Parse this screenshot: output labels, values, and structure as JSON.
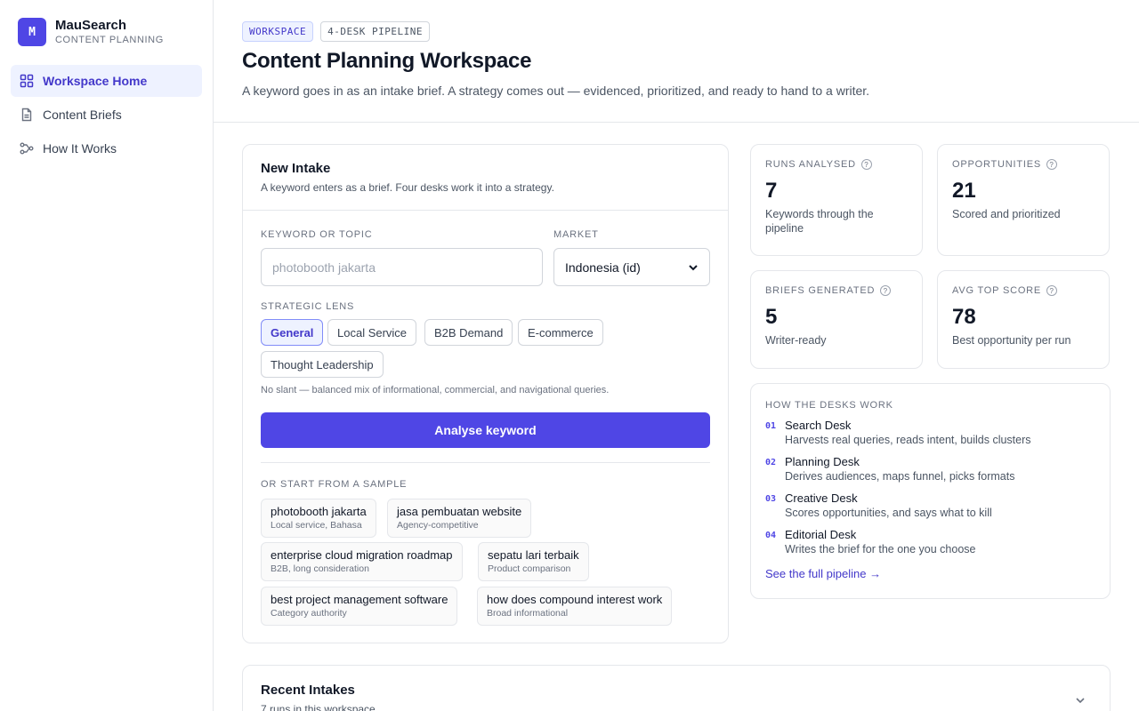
{
  "sidebar": {
    "logo_letter": "M",
    "brand_name": "MauSearch",
    "brand_sub": "CONTENT PLANNING",
    "items": [
      {
        "label": "Workspace Home",
        "icon": "grid-icon",
        "active": true
      },
      {
        "label": "Content Briefs",
        "icon": "document-icon",
        "active": false
      },
      {
        "label": "How It Works",
        "icon": "flow-icon",
        "active": false
      }
    ]
  },
  "header": {
    "tags": [
      "WORKSPACE",
      "4-DESK PIPELINE"
    ],
    "title": "Content Planning Workspace",
    "description": "A keyword goes in as an intake brief. A strategy comes out — evidenced, prioritized, and ready to hand to a writer."
  },
  "intake": {
    "title": "New Intake",
    "subtitle": "A keyword enters as a brief. Four desks work it into a strategy.",
    "keyword_label": "KEYWORD OR TOPIC",
    "keyword_placeholder": "photobooth jakarta",
    "market_label": "MARKET",
    "market_value": "Indonesia (id)",
    "lens_label": "STRATEGIC LENS",
    "lenses": [
      "General",
      "Local Service",
      "B2B Demand",
      "E-commerce",
      "Thought Leadership"
    ],
    "active_lens": "General",
    "lens_hint": "No slant — balanced mix of informational, commercial, and navigational queries.",
    "analyse_label": "Analyse keyword",
    "samples_label": "OR START FROM A SAMPLE",
    "samples": [
      {
        "title": "photobooth jakarta",
        "sub": "Local service, Bahasa"
      },
      {
        "title": "jasa pembuatan website",
        "sub": "Agency-competitive"
      },
      {
        "title": "enterprise cloud migration roadmap",
        "sub": "B2B, long consideration"
      },
      {
        "title": "sepatu lari terbaik",
        "sub": "Product comparison"
      },
      {
        "title": "best project management software",
        "sub": "Category authority"
      },
      {
        "title": "how does compound interest work",
        "sub": "Broad informational"
      }
    ]
  },
  "stats": [
    {
      "label": "RUNS ANALYSED",
      "value": "7",
      "desc": "Keywords through the pipeline"
    },
    {
      "label": "OPPORTUNITIES",
      "value": "21",
      "desc": "Scored and prioritized"
    },
    {
      "label": "BRIEFS GENERATED",
      "value": "5",
      "desc": "Writer-ready"
    },
    {
      "label": "AVG TOP SCORE",
      "value": "78",
      "desc": "Best opportunity per run"
    }
  ],
  "desks": {
    "label": "HOW THE DESKS WORK",
    "items": [
      {
        "num": "01",
        "name": "Search Desk",
        "text": "Harvests real queries, reads intent, builds clusters"
      },
      {
        "num": "02",
        "name": "Planning Desk",
        "text": "Derives audiences, maps funnel, picks formats"
      },
      {
        "num": "03",
        "name": "Creative Desk",
        "text": "Scores opportunities, and says what to kill"
      },
      {
        "num": "04",
        "name": "Editorial Desk",
        "text": "Writes the brief for the one you choose"
      }
    ],
    "link": "See the full pipeline →"
  },
  "recent": {
    "title": "Recent Intakes",
    "subtitle": "7 runs in this workspace"
  },
  "colors": {
    "accent": "#4f46e5",
    "accent_soft": "#eef2ff",
    "border": "#e5e7eb"
  }
}
